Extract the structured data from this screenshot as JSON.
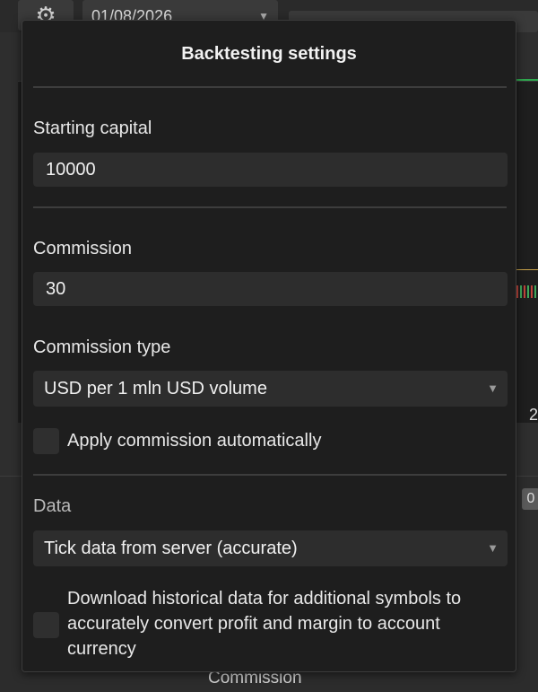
{
  "background": {
    "date_value": "01/08/2026",
    "axis_label": "2",
    "lower_tab_label": "0",
    "bottom_label": "Commission"
  },
  "dialog": {
    "title": "Backtesting settings",
    "starting_capital": {
      "label": "Starting capital",
      "value": "10000"
    },
    "commission": {
      "label": "Commission",
      "value": "30"
    },
    "commission_type": {
      "label": "Commission type",
      "selected": "USD per 1 mln USD volume"
    },
    "apply_commission": {
      "label": "Apply commission automatically",
      "checked": false
    },
    "data": {
      "label": "Data",
      "selected": "Tick data from server (accurate)"
    },
    "download_historical": {
      "label": "Download historical data for additional symbols to accurately convert profit and margin to account currency",
      "checked": false
    }
  },
  "icons": {
    "gear": "gear-icon",
    "dropdown": "chevron-down-icon"
  },
  "colors": {
    "dialog_bg": "#1e1e1e",
    "field_bg": "#2d2d2d",
    "text": "#e8e8e8",
    "divider": "#3d3d3d"
  }
}
